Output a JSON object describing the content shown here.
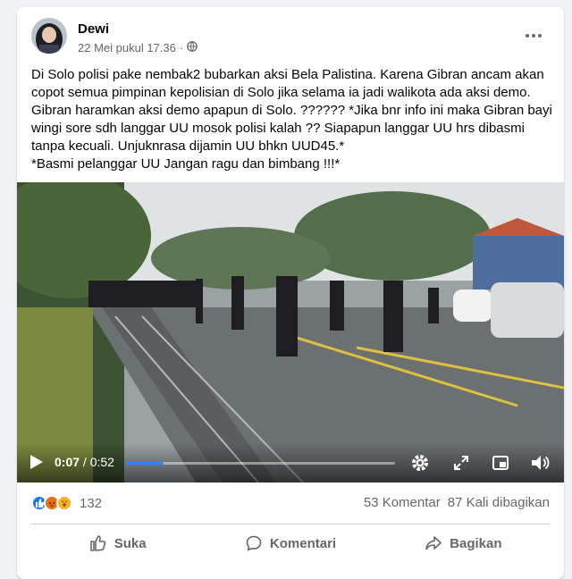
{
  "post": {
    "author": "Dewi",
    "timestamp": "22 Mei pukul 17.36",
    "separator": "·",
    "privacy_icon": "globe-icon",
    "text": "Di Solo polisi pake nembak2 bubarkan aksi Bela Palistina. Karena Gibran ancam akan copot semua pimpinan kepolisian di Solo jika selama ia jadi walikota ada aksi demo. Gibran haramkan aksi demo apapun di Solo. ?????? *Jika bnr info ini maka Gibran bayi wingi sore sdh langgar UU mosok polisi kalah ?? Siapapun langgar UU hrs dibasmi tanpa kecuali. Unjuknrasa dijamin UU bhkn UUD45.*\n*Basmi pelanggar UU Jangan ragu dan bimbang !!!*"
  },
  "video": {
    "current_time": "0:07",
    "time_separator": "/",
    "duration": "0:52",
    "progress": 0.135,
    "icons": [
      "play-icon",
      "settings-icon",
      "fullscreen-icon",
      "picture-in-picture-icon",
      "volume-icon"
    ]
  },
  "stats": {
    "reactions": [
      "like",
      "angry",
      "wow"
    ],
    "reaction_count": "132",
    "comments": "53 Komentar",
    "shares": "87 Kali dibagikan"
  },
  "actions": {
    "like": "Suka",
    "comment": "Komentari",
    "share": "Bagikan"
  },
  "colors": {
    "accent": "#2d88ff",
    "like": "#1877f2",
    "angry": "#e9710f",
    "wow": "#f7b125",
    "secondary_text": "#65676b"
  }
}
